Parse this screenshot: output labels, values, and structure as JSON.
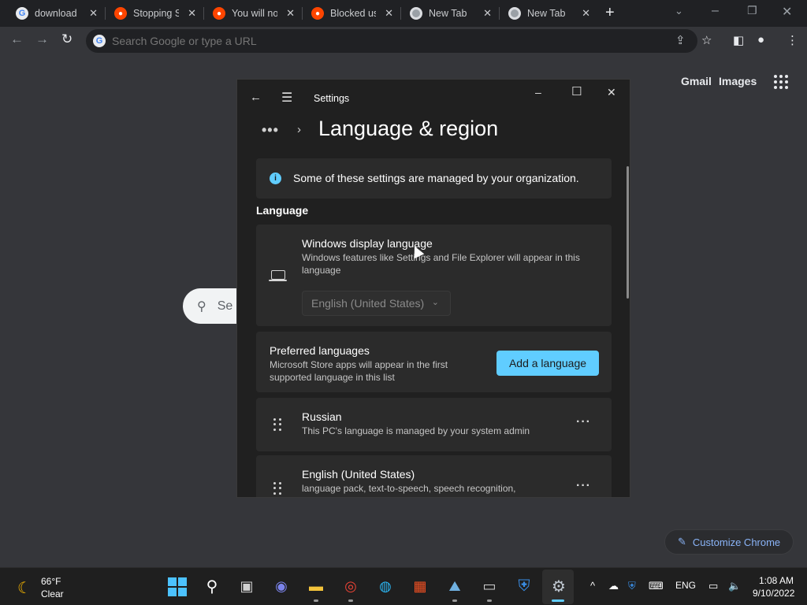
{
  "browser": {
    "tabs": [
      {
        "title": "download",
        "favicon": "google-icon"
      },
      {
        "title": "Stopping S",
        "favicon": "reddit-icon"
      },
      {
        "title": "You will no",
        "favicon": "reddit-icon"
      },
      {
        "title": "Blocked us",
        "favicon": "reddit-icon"
      },
      {
        "title": "New Tab",
        "favicon": "chrome-icon"
      },
      {
        "title": "New Tab",
        "favicon": "chrome-icon"
      }
    ],
    "omnibox_placeholder": "Search Google or type a URL",
    "ntp": {
      "gmail": "Gmail",
      "images": "Images",
      "search_placeholder": "Se",
      "customize": "Customize Chrome"
    }
  },
  "settings": {
    "window_title": "Settings",
    "page_title": "Language & region",
    "info": "Some of these settings are managed by your organization.",
    "section": "Language",
    "display_language": {
      "title": "Windows display language",
      "subtitle_line1": "Windows features like Settings and File Explorer will appear in this",
      "subtitle_line2": "language",
      "selected": "English (United States)"
    },
    "preferred": {
      "title": "Preferred languages",
      "subtitle_line1": "Microsoft Store apps will appear in the first",
      "subtitle_line2": "supported language in this list",
      "add_button": "Add a language"
    },
    "languages": [
      {
        "name": "Russian",
        "detail": "This PC's language is managed by your system admin"
      },
      {
        "name": "English (United States)",
        "detail": "language pack, text-to-speech, speech recognition,"
      }
    ]
  },
  "taskbar": {
    "weather_temp": "66°F",
    "weather_cond": "Clear",
    "input_lang": "ENG",
    "time": "1:08 AM",
    "date": "9/10/2022"
  },
  "colors": {
    "accent": "#60cdff",
    "chrome_link": "#8ab4f8",
    "reddit": "#ff4500"
  }
}
